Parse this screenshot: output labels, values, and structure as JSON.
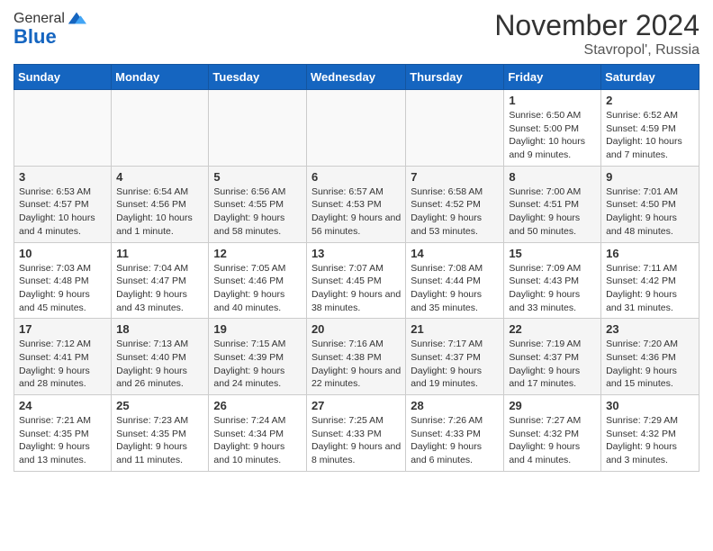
{
  "header": {
    "logo_general": "General",
    "logo_blue": "Blue",
    "month_title": "November 2024",
    "location": "Stavropol', Russia"
  },
  "days_of_week": [
    "Sunday",
    "Monday",
    "Tuesday",
    "Wednesday",
    "Thursday",
    "Friday",
    "Saturday"
  ],
  "weeks": [
    {
      "days": [
        {
          "number": "",
          "info": ""
        },
        {
          "number": "",
          "info": ""
        },
        {
          "number": "",
          "info": ""
        },
        {
          "number": "",
          "info": ""
        },
        {
          "number": "",
          "info": ""
        },
        {
          "number": "1",
          "info": "Sunrise: 6:50 AM\nSunset: 5:00 PM\nDaylight: 10 hours and 9 minutes."
        },
        {
          "number": "2",
          "info": "Sunrise: 6:52 AM\nSunset: 4:59 PM\nDaylight: 10 hours and 7 minutes."
        }
      ]
    },
    {
      "days": [
        {
          "number": "3",
          "info": "Sunrise: 6:53 AM\nSunset: 4:57 PM\nDaylight: 10 hours and 4 minutes."
        },
        {
          "number": "4",
          "info": "Sunrise: 6:54 AM\nSunset: 4:56 PM\nDaylight: 10 hours and 1 minute."
        },
        {
          "number": "5",
          "info": "Sunrise: 6:56 AM\nSunset: 4:55 PM\nDaylight: 9 hours and 58 minutes."
        },
        {
          "number": "6",
          "info": "Sunrise: 6:57 AM\nSunset: 4:53 PM\nDaylight: 9 hours and 56 minutes."
        },
        {
          "number": "7",
          "info": "Sunrise: 6:58 AM\nSunset: 4:52 PM\nDaylight: 9 hours and 53 minutes."
        },
        {
          "number": "8",
          "info": "Sunrise: 7:00 AM\nSunset: 4:51 PM\nDaylight: 9 hours and 50 minutes."
        },
        {
          "number": "9",
          "info": "Sunrise: 7:01 AM\nSunset: 4:50 PM\nDaylight: 9 hours and 48 minutes."
        }
      ]
    },
    {
      "days": [
        {
          "number": "10",
          "info": "Sunrise: 7:03 AM\nSunset: 4:48 PM\nDaylight: 9 hours and 45 minutes."
        },
        {
          "number": "11",
          "info": "Sunrise: 7:04 AM\nSunset: 4:47 PM\nDaylight: 9 hours and 43 minutes."
        },
        {
          "number": "12",
          "info": "Sunrise: 7:05 AM\nSunset: 4:46 PM\nDaylight: 9 hours and 40 minutes."
        },
        {
          "number": "13",
          "info": "Sunrise: 7:07 AM\nSunset: 4:45 PM\nDaylight: 9 hours and 38 minutes."
        },
        {
          "number": "14",
          "info": "Sunrise: 7:08 AM\nSunset: 4:44 PM\nDaylight: 9 hours and 35 minutes."
        },
        {
          "number": "15",
          "info": "Sunrise: 7:09 AM\nSunset: 4:43 PM\nDaylight: 9 hours and 33 minutes."
        },
        {
          "number": "16",
          "info": "Sunrise: 7:11 AM\nSunset: 4:42 PM\nDaylight: 9 hours and 31 minutes."
        }
      ]
    },
    {
      "days": [
        {
          "number": "17",
          "info": "Sunrise: 7:12 AM\nSunset: 4:41 PM\nDaylight: 9 hours and 28 minutes."
        },
        {
          "number": "18",
          "info": "Sunrise: 7:13 AM\nSunset: 4:40 PM\nDaylight: 9 hours and 26 minutes."
        },
        {
          "number": "19",
          "info": "Sunrise: 7:15 AM\nSunset: 4:39 PM\nDaylight: 9 hours and 24 minutes."
        },
        {
          "number": "20",
          "info": "Sunrise: 7:16 AM\nSunset: 4:38 PM\nDaylight: 9 hours and 22 minutes."
        },
        {
          "number": "21",
          "info": "Sunrise: 7:17 AM\nSunset: 4:37 PM\nDaylight: 9 hours and 19 minutes."
        },
        {
          "number": "22",
          "info": "Sunrise: 7:19 AM\nSunset: 4:37 PM\nDaylight: 9 hours and 17 minutes."
        },
        {
          "number": "23",
          "info": "Sunrise: 7:20 AM\nSunset: 4:36 PM\nDaylight: 9 hours and 15 minutes."
        }
      ]
    },
    {
      "days": [
        {
          "number": "24",
          "info": "Sunrise: 7:21 AM\nSunset: 4:35 PM\nDaylight: 9 hours and 13 minutes."
        },
        {
          "number": "25",
          "info": "Sunrise: 7:23 AM\nSunset: 4:35 PM\nDaylight: 9 hours and 11 minutes."
        },
        {
          "number": "26",
          "info": "Sunrise: 7:24 AM\nSunset: 4:34 PM\nDaylight: 9 hours and 10 minutes."
        },
        {
          "number": "27",
          "info": "Sunrise: 7:25 AM\nSunset: 4:33 PM\nDaylight: 9 hours and 8 minutes."
        },
        {
          "number": "28",
          "info": "Sunrise: 7:26 AM\nSunset: 4:33 PM\nDaylight: 9 hours and 6 minutes."
        },
        {
          "number": "29",
          "info": "Sunrise: 7:27 AM\nSunset: 4:32 PM\nDaylight: 9 hours and 4 minutes."
        },
        {
          "number": "30",
          "info": "Sunrise: 7:29 AM\nSunset: 4:32 PM\nDaylight: 9 hours and 3 minutes."
        }
      ]
    }
  ]
}
